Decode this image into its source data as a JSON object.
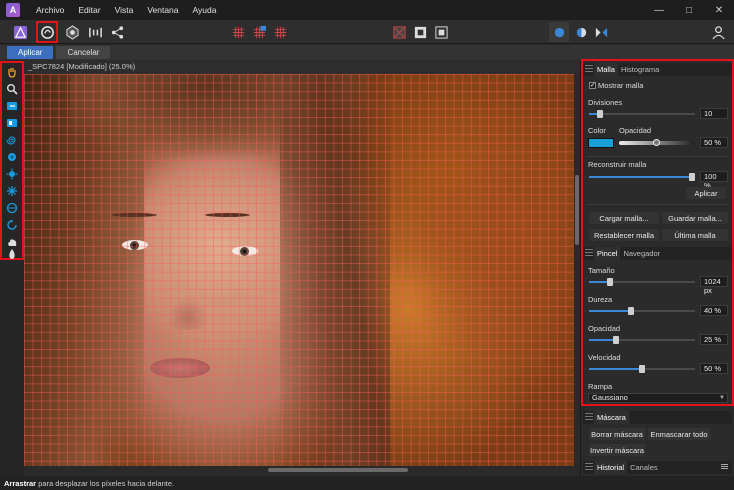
{
  "menubar": {
    "items": [
      "Archivo",
      "Editar",
      "Vista",
      "Ventana",
      "Ayuda"
    ],
    "logo_letter": "A"
  },
  "toolbar": {
    "left_icons": [
      "persona-photo-icon",
      "liquify-persona-icon",
      "develop-persona-icon",
      "tone-mapping-icon",
      "export-persona-icon"
    ],
    "center_icons": [
      "grid-a-icon",
      "grid-b-icon",
      "grid-c-icon",
      "mask-off-icon",
      "mask-on-icon",
      "mask-invert-icon"
    ],
    "right_icons": [
      "view-full-icon",
      "view-split-icon",
      "view-mirror-icon",
      "user-icon"
    ]
  },
  "context": {
    "apply_label": "Aplicar",
    "cancel_label": "Cancelar"
  },
  "document": {
    "title": "_SPC7824 [Modificado] (25.0%)"
  },
  "status": {
    "bold": "Arrastrar",
    "text": " para desplazar los píxeles hacia delante."
  },
  "mesh_panel": {
    "tabs": [
      "Malla",
      "Histograma"
    ],
    "show_mesh_label": "Mostrar malla",
    "show_mesh_checked": true,
    "divisions_label": "Divisiones",
    "divisions_value": "10",
    "color_label": "Color",
    "color_hex": "#1aa0d8",
    "opacity_label": "Opacidad",
    "opacity_value": "50 %",
    "rebuild_label": "Reconstruir malla",
    "rebuild_value": "100 %",
    "apply_label": "Aplicar",
    "load_label": "Cargar malla...",
    "save_label": "Guardar malla...",
    "reset_label": "Restablecer malla",
    "last_label": "Última malla"
  },
  "brush_panel": {
    "tabs": [
      "Pincel",
      "Navegador"
    ],
    "size_label": "Tamaño",
    "size_value": "1024 px",
    "hardness_label": "Dureza",
    "hardness_value": "40 %",
    "opacity_label": "Opacidad",
    "opacity_value": "25 %",
    "speed_label": "Velocidad",
    "speed_value": "50 %",
    "ramp_label": "Rampa",
    "ramp_value": "Gaussiano"
  },
  "mask_panel": {
    "tab": "Máscara",
    "clear_label": "Borrar máscara",
    "mask_all_label": "Enmascarar todo",
    "invert_label": "Invertir máscara"
  },
  "bottom_tabs": [
    "Historial",
    "Canales"
  ],
  "levels": {
    "divisions": 0.1,
    "opacity": 0.5,
    "rebuild": 1.0,
    "size": 0.2,
    "hardness": 0.4,
    "brush_opacity": 0.25,
    "speed": 0.5
  }
}
